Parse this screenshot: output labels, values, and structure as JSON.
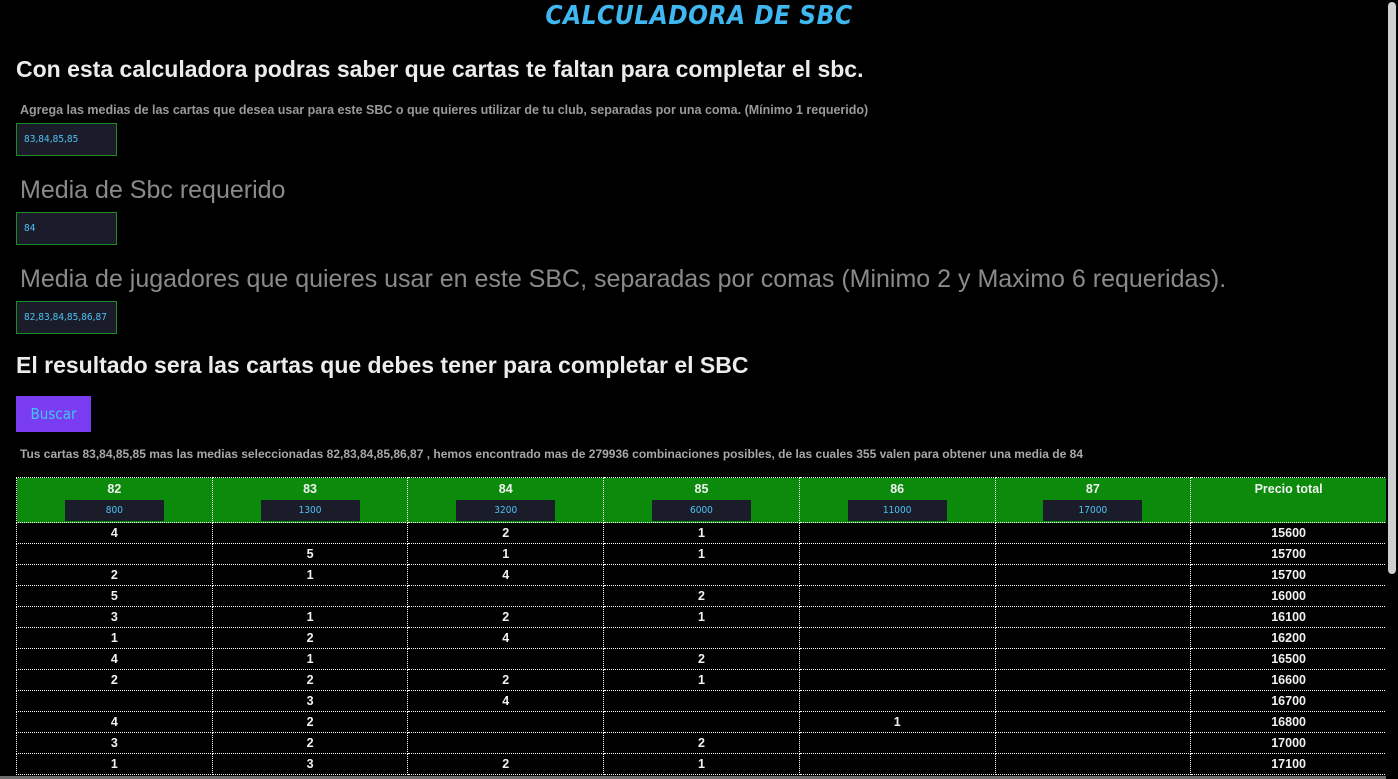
{
  "header": {
    "title": "CALCULADORA DE SBC",
    "intro": "Con esta calculadora podras saber que cartas te faltan para completar el sbc."
  },
  "form": {
    "cards_hint": "Agrega las medias de las cartas que desea usar para este SBC o que quieres utilizar de tu club, separadas por una coma. (Mínimo 1 requerido)",
    "cards_value": "83,84,85,85",
    "required_label": "Media de Sbc requerido",
    "required_value": "84",
    "players_label": "Media de jugadores que quieres usar en este SBC, separadas por comas (Minimo 2 y Maximo 6 requeridas).",
    "players_value": "82,83,84,85,86,87",
    "result_title": "El resultado sera las cartas que debes tener para completar el SBC",
    "search_label": "Buscar"
  },
  "summary": "Tus cartas 83,84,85,85 mas las medias seleccionadas 82,83,84,85,86,87 , hemos encontrado mas de 279936 combinaciones posibles, de las cuales 355 valen para obtener una media de 84",
  "table": {
    "columns": [
      {
        "label": "82",
        "price": "800"
      },
      {
        "label": "83",
        "price": "1300"
      },
      {
        "label": "84",
        "price": "3200"
      },
      {
        "label": "85",
        "price": "6000"
      },
      {
        "label": "86",
        "price": "11000"
      },
      {
        "label": "87",
        "price": "17000"
      }
    ],
    "total_label": "Precio total",
    "rows": [
      [
        "4",
        "",
        "2",
        "1",
        "",
        "",
        "15600"
      ],
      [
        "",
        "5",
        "1",
        "1",
        "",
        "",
        "15700"
      ],
      [
        "2",
        "1",
        "4",
        "",
        "",
        "",
        "15700"
      ],
      [
        "5",
        "",
        "",
        "2",
        "",
        "",
        "16000"
      ],
      [
        "3",
        "1",
        "2",
        "1",
        "",
        "",
        "16100"
      ],
      [
        "1",
        "2",
        "4",
        "",
        "",
        "",
        "16200"
      ],
      [
        "4",
        "1",
        "",
        "2",
        "",
        "",
        "16500"
      ],
      [
        "2",
        "2",
        "2",
        "1",
        "",
        "",
        "16600"
      ],
      [
        "",
        "3",
        "4",
        "",
        "",
        "",
        "16700"
      ],
      [
        "4",
        "2",
        "",
        "",
        "1",
        "",
        "16800"
      ],
      [
        "3",
        "2",
        "",
        "2",
        "",
        "",
        "17000"
      ],
      [
        "1",
        "3",
        "2",
        "1",
        "",
        "",
        "17100"
      ]
    ]
  },
  "colors": {
    "title": "#3fb7f0",
    "button_bg": "#7a3cf0",
    "header_green": "#0b8a0b",
    "input_bg": "#1b1c2a",
    "input_text": "#4ec3f5"
  }
}
